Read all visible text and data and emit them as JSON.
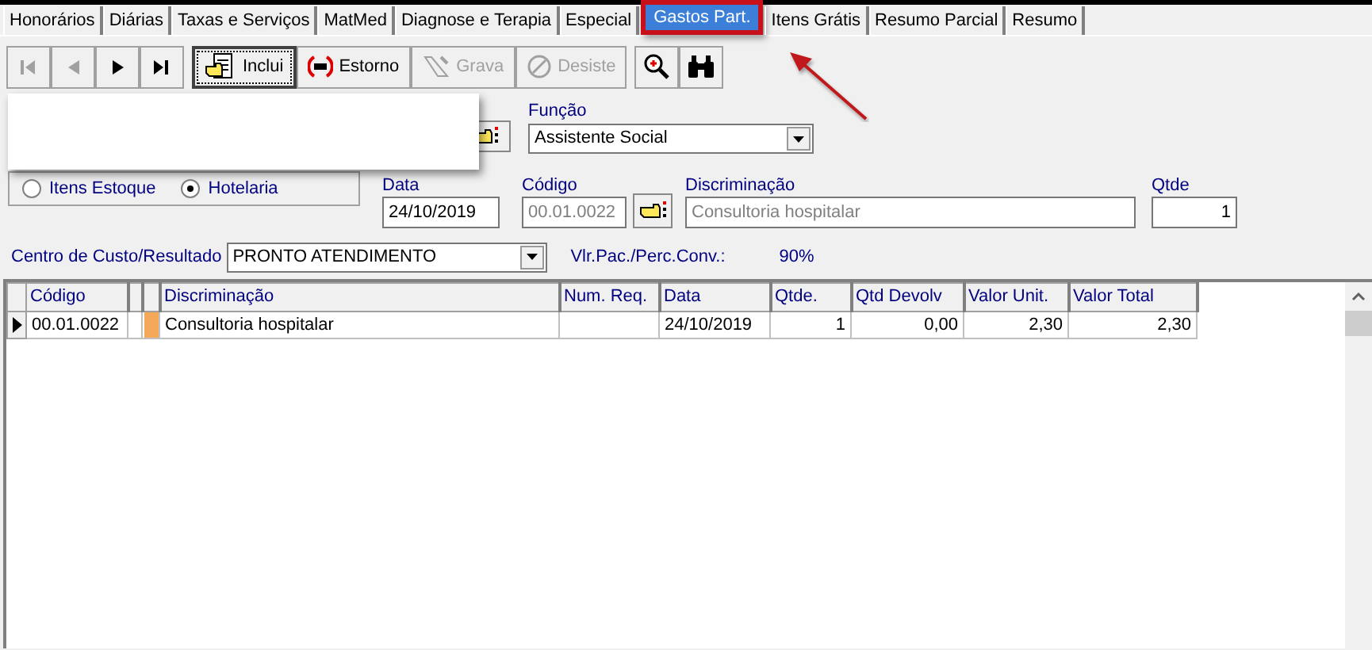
{
  "tabs": [
    {
      "label": "Honorários",
      "selected": false
    },
    {
      "label": "Diárias",
      "selected": false
    },
    {
      "label": "Taxas e Serviços",
      "selected": false
    },
    {
      "label": "MatMed",
      "selected": false
    },
    {
      "label": "Diagnose e Terapia",
      "selected": false
    },
    {
      "label": "Especial",
      "selected": false
    },
    {
      "label": "Gastos Part.",
      "selected": true
    },
    {
      "label": "Itens Grátis",
      "selected": false
    },
    {
      "label": "Resumo Parcial",
      "selected": false
    },
    {
      "label": "Resumo",
      "selected": false
    }
  ],
  "toolbar": [
    {
      "kind": "first",
      "disabled": true
    },
    {
      "kind": "prev",
      "disabled": true
    },
    {
      "kind": "next",
      "disabled": false
    },
    {
      "kind": "last",
      "disabled": false
    },
    {
      "kind": "include",
      "label": "Inclui",
      "disabled": false
    },
    {
      "kind": "reverse",
      "label": "Estorno",
      "disabled": false
    },
    {
      "kind": "save",
      "label": "Grava",
      "disabled": true
    },
    {
      "kind": "cancel",
      "label": "Desiste",
      "disabled": true
    },
    {
      "kind": "zoom",
      "disabled": false
    },
    {
      "kind": "find",
      "disabled": false
    }
  ],
  "funcao": {
    "label": "Função",
    "value": "Assistente Social"
  },
  "source": [
    {
      "label": "Itens Estoque",
      "selected": false
    },
    {
      "label": "Hotelaria",
      "selected": true
    }
  ],
  "data": {
    "label": "Data",
    "value": "24/10/2019"
  },
  "codigo": {
    "label": "Código",
    "value": "00.01.0022"
  },
  "discriminacao": {
    "label": "Discriminação",
    "value": "Consultoria hospitalar"
  },
  "qtde": {
    "label": "Qtde",
    "value": "1"
  },
  "centro": {
    "label": "Centro de Custo/Resultado",
    "value": "PRONTO ATENDIMENTO"
  },
  "vlr_pac": {
    "label": "Vlr.Pac./Perc.Conv.:",
    "value": "90%"
  },
  "table": {
    "columns": [
      "Código",
      "",
      "",
      "Discriminação",
      "Num. Req.",
      "Data",
      "Qtde.",
      "Qtd Devolv",
      "Valor Unit.",
      "Valor Total"
    ],
    "rows": [
      {
        "selected": true,
        "color": "#f4a95a",
        "cells": [
          "00.01.0022",
          "",
          "",
          "Consultoria hospitalar",
          "",
          "24/10/2019",
          "1",
          "0,00",
          "2,30",
          "2,30"
        ]
      }
    ]
  }
}
